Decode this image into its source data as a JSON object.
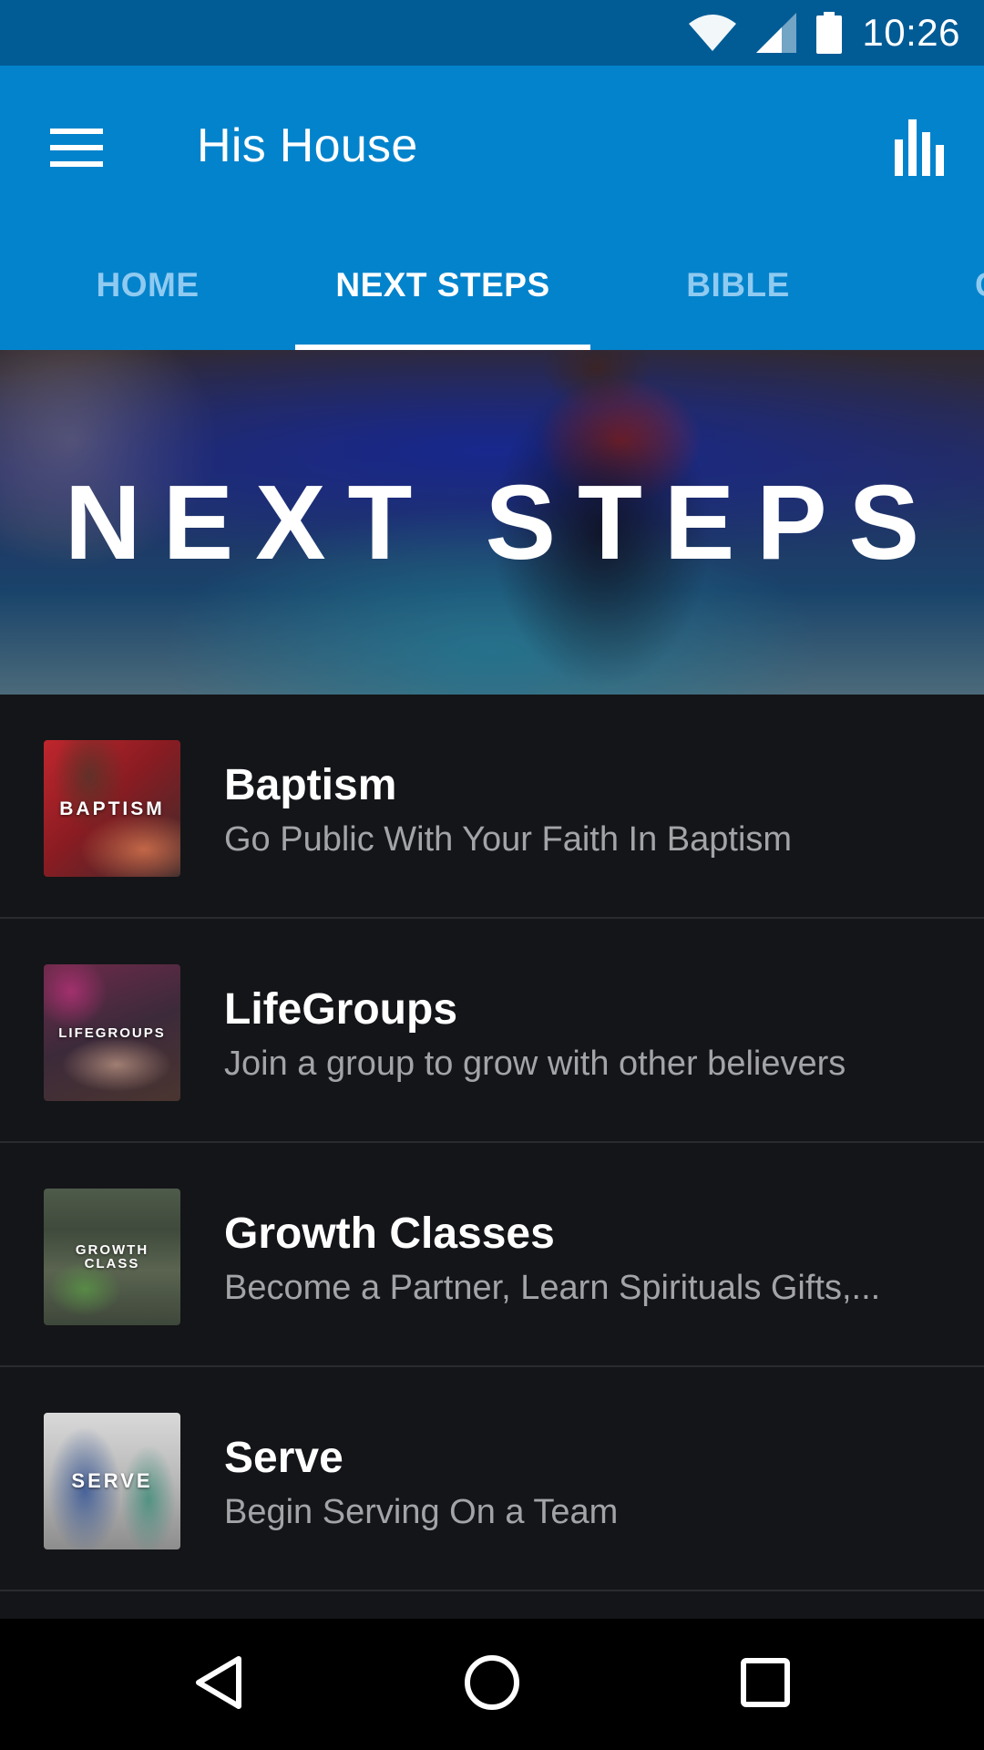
{
  "status_bar": {
    "time": "10:26",
    "icons": [
      "wifi-icon",
      "cell-signal-icon",
      "battery-icon"
    ]
  },
  "app_bar": {
    "title": "His House",
    "menu_icon": "hamburger-menu-icon",
    "action_icon": "bar-chart-icon"
  },
  "tabs": [
    {
      "label": "HOME",
      "active": false
    },
    {
      "label": "NEXT STEPS",
      "active": true
    },
    {
      "label": "BIBLE",
      "active": false
    },
    {
      "label": "C",
      "active": false
    }
  ],
  "hero": {
    "title": "NEXT STEPS"
  },
  "items": [
    {
      "title": "Baptism",
      "subtitle": "Go Public With Your Faith In Baptism",
      "thumb_label": "BAPTISM"
    },
    {
      "title": "LifeGroups",
      "subtitle": "Join a group to grow with other believers",
      "thumb_label": "LIFEGROUPS"
    },
    {
      "title": "Growth Classes",
      "subtitle": "Become a Partner, Learn Spirituals Gifts,...",
      "thumb_label_line1": "GROWTH",
      "thumb_label_line2": "CLASS"
    },
    {
      "title": "Serve",
      "subtitle": "Begin Serving On a Team",
      "thumb_label": "SERVE"
    }
  ],
  "nav_bar": {
    "icons": [
      "back-icon",
      "home-icon",
      "recents-icon"
    ]
  },
  "colors": {
    "status_bar": "#015c96",
    "app_bar": "#0383cc",
    "tab_inactive": "#8fcaf0",
    "list_background": "#141518",
    "subtitle_text": "#a2a4a8"
  }
}
